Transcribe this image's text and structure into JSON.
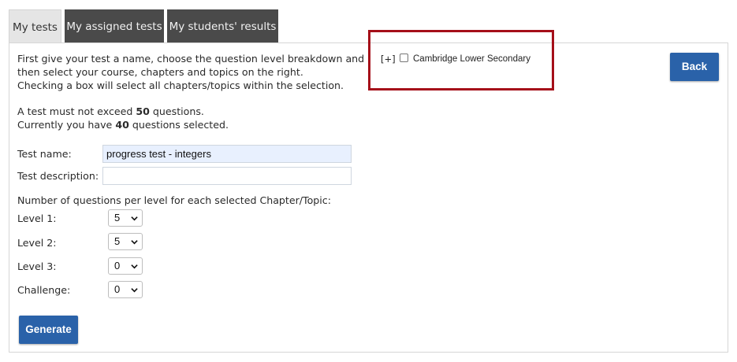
{
  "tabs": [
    {
      "label": "My tests",
      "active": true
    },
    {
      "label": "My assigned tests",
      "active": false
    },
    {
      "label": "My students' results",
      "active": false
    }
  ],
  "intro": {
    "line1": "First give your test a name, choose the question level breakdown and",
    "line2": "then select your course, chapters and topics on the right.",
    "line3": "Checking a box will select all chapters/topics within the selection."
  },
  "limits": {
    "max_prefix": "A test must not exceed ",
    "max_value": "50",
    "max_suffix": " questions.",
    "current_prefix": "Currently you have ",
    "current_value": "40",
    "current_suffix": " questions selected."
  },
  "form": {
    "name_label": "Test name:",
    "name_value": "progress test - integers",
    "description_label": "Test description:",
    "description_value": "",
    "levels_heading": "Number of questions per level for each selected Chapter/Topic:",
    "levels": [
      {
        "label": "Level 1:",
        "value": "5"
      },
      {
        "label": "Level 2:",
        "value": "5"
      },
      {
        "label": "Level 3:",
        "value": "0"
      },
      {
        "label": "Challenge:",
        "value": "0"
      }
    ]
  },
  "buttons": {
    "back": "Back",
    "generate": "Generate"
  },
  "course_tree": {
    "expander": "[+]",
    "course": "Cambridge Lower Secondary",
    "checked": false
  },
  "colors": {
    "button": "#2a62a9",
    "highlight": "#a50f19",
    "active_tab": "#e5e5e5",
    "inactive_tab": "#4a4a4a",
    "filled_input": "#e8f0fe"
  }
}
